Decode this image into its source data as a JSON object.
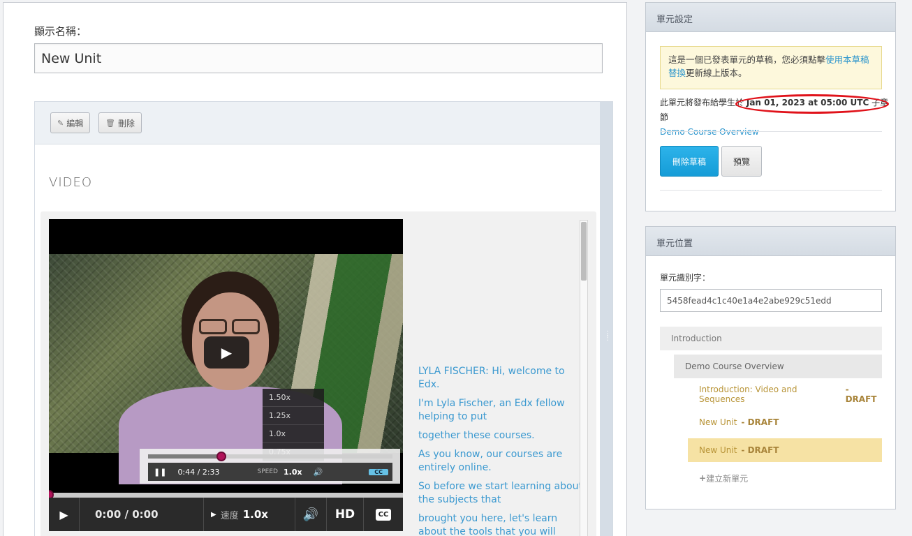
{
  "unit_form": {
    "name_label": "顯示名稱：",
    "name_value": "New Unit"
  },
  "component": {
    "edit_label": "編輯",
    "delete_label": "刪除",
    "heading": "VIDEO"
  },
  "video": {
    "inner_speed_options": [
      "1.50x",
      "1.25x",
      "1.0x",
      "0.75x"
    ],
    "inner_time": "0:44 / 2:33",
    "inner_speed_label": "SPEED",
    "inner_speed_value": "1.0x",
    "inner_cc": "CC",
    "progress_fraction": 0,
    "time": "0:00 / 0:00",
    "speed_label": "速度",
    "speed_value": "1.0x",
    "hd_label": "HD",
    "cc_label": "CC"
  },
  "transcript": [
    "LYLA FISCHER: Hi, welcome to Edx.",
    "I'm Lyla Fischer, an Edx fellow helping to put",
    "together these courses.",
    "As you know, our courses are entirely online.",
    "So before we start learning about the subjects that",
    "brought you here, let's learn about the tools that you will"
  ],
  "unit_settings": {
    "title": "單元設定",
    "notice_prefix": "這是一個已發表單元的草稿，您必須點擊",
    "notice_link": "使用本草稿替換",
    "notice_suffix": "更新線上版本。",
    "release_prefix": "此單元將發布給學生",
    "release_on": "於",
    "release_date": "Jan 01, 2023 at 05:00 UTC",
    "release_suffix": "子章節",
    "subsection_link": "Demo Course Overview",
    "delete_draft": "刪除草稿",
    "preview": "預覽"
  },
  "unit_location": {
    "title": "單元位置",
    "id_label": "單元識別字：",
    "id_value": "5458fead4c1c40e1a4e2abe929c51edd",
    "section": "Introduction",
    "subsection": "Demo Course Overview",
    "units": [
      {
        "name": "Introduction: Video and Sequences",
        "draft": "- DRAFT"
      },
      {
        "name": "New Unit",
        "draft": "- DRAFT"
      },
      {
        "name": "New Unit",
        "draft": "- DRAFT"
      }
    ],
    "new_unit": "建立新單元"
  },
  "colors": {
    "accent": "#2b95cd",
    "draft": "#a8843a",
    "active_unit": "#f6e2a4",
    "annotation": "#e0121a"
  }
}
